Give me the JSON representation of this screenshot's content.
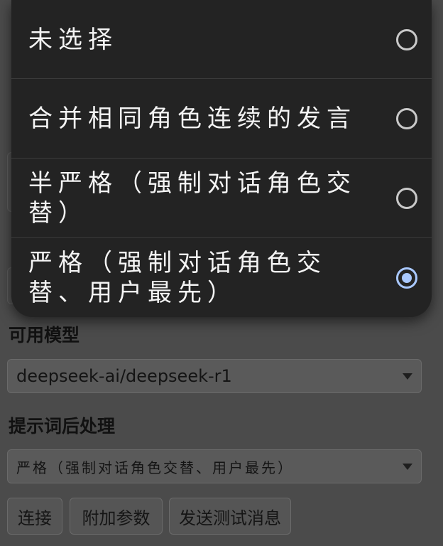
{
  "dropdown": {
    "options": [
      {
        "label": "未选择",
        "selected": false
      },
      {
        "label": "合并相同角色连续的发言",
        "selected": false
      },
      {
        "label": "半严格（强制对话角色交替）",
        "selected": false
      },
      {
        "label": "严格（强制对话角色交替、用户最先）",
        "selected": true
      }
    ],
    "accent_color": "#a9c8ff"
  },
  "form": {
    "model_label": "可用模型",
    "model_value": "deepseek-ai/deepseek-r1",
    "postprocess_label": "提示词后处理",
    "postprocess_value": "严格（强制对话角色交替、用户最先）",
    "buttons": {
      "connect": "连接",
      "extra_params": "附加参数",
      "send_test": "发送测试消息"
    }
  }
}
